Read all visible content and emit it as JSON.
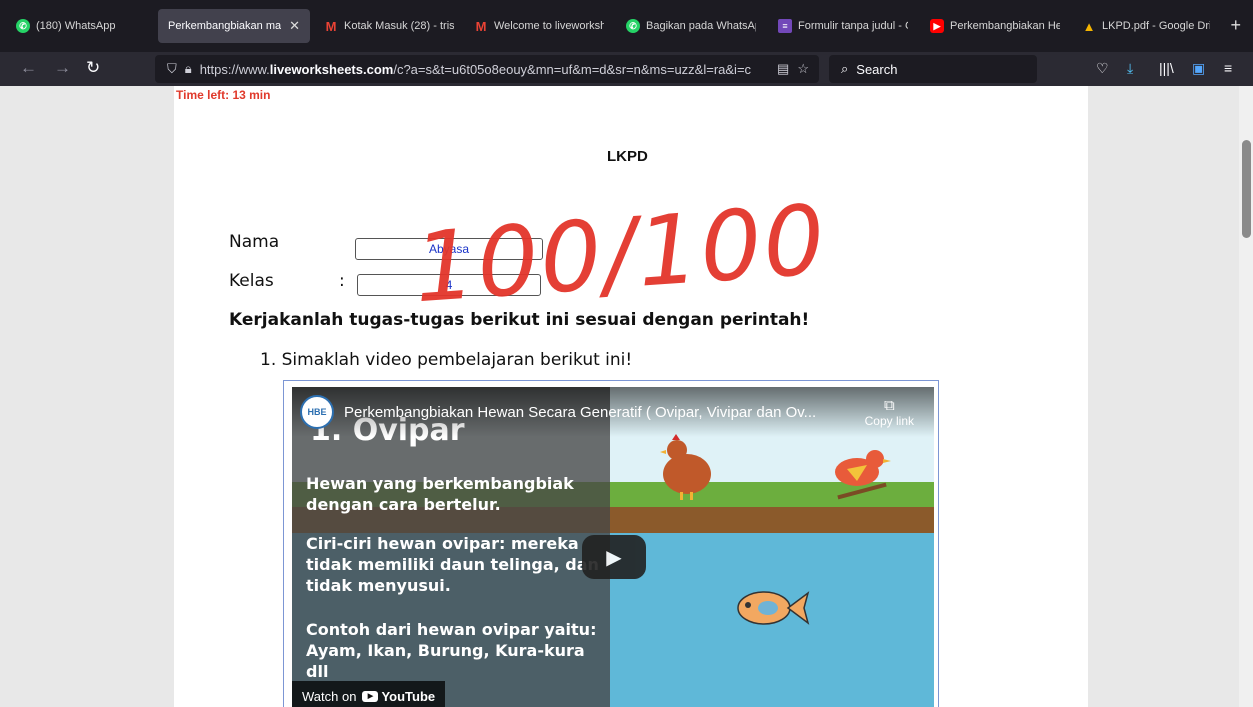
{
  "browser": {
    "tabs": [
      {
        "label": "(180) WhatsApp",
        "icon": "whatsapp-icon",
        "color": "#25d366",
        "active": false
      },
      {
        "label": "Perkembangbiakan mahl",
        "icon": "",
        "color": "",
        "active": true
      },
      {
        "label": "Kotak Masuk (28) - tris",
        "icon": "gmail-icon",
        "color": "#ea4335",
        "active": false
      },
      {
        "label": "Welcome to liveworksh",
        "icon": "gmail-icon",
        "color": "#ea4335",
        "active": false
      },
      {
        "label": "Bagikan pada WhatsAp",
        "icon": "whatsapp-icon",
        "color": "#25d366",
        "active": false
      },
      {
        "label": "Formulir tanpa judul - G",
        "icon": "forms-icon",
        "color": "#7248b9",
        "active": false
      },
      {
        "label": "Perkembangbiakan Hew",
        "icon": "youtube-icon",
        "color": "#ff0000",
        "active": false
      },
      {
        "label": "LKPD.pdf - Google Driv",
        "icon": "drive-icon",
        "color": "#f4b400",
        "active": false
      }
    ],
    "new_tab": "+",
    "url_prefix": "https://www.",
    "url_domain": "liveworksheets.com",
    "url_rest": "/c?a=s&t=u6t05o8eouy&mn=uf&m=d&sr=n&ms=uzz&l=ra&i=c",
    "search_placeholder": "Search"
  },
  "worksheet": {
    "time_left": "Time left: 13 min",
    "title": "LKPD",
    "score": "100/100",
    "name_label": "Nama",
    "name_value": "Abyasa",
    "class_label": "Kelas",
    "class_value": "4",
    "colon": ":",
    "instruction": "Kerjakanlah tugas-tugas berikut ini sesuai dengan perintah!",
    "step1": "1.  Simaklah video pembelajaran berikut ini!"
  },
  "video": {
    "channel": "HBE",
    "title": "Perkembangbiakan Hewan Secara Generatif ( Ovipar, Vivipar dan Ov...",
    "copy_link": "Copy link",
    "heading": "1. Ovipar",
    "text1": "Hewan yang berkembangbiak dengan cara bertelur.",
    "text2": "Ciri-ciri hewan ovipar: mereka tidak memiliki daun telinga, dan tidak menyusui.",
    "text3": "Contoh dari hewan ovipar yaitu: Ayam, Ikan, Burung, Kura-kura dll",
    "watch_on": "Watch on",
    "youtube": "YouTube"
  },
  "colors": {
    "accent_red": "#e3352b",
    "input_text": "#1a33c8",
    "tabbar": "#1c1b22",
    "navbar": "#2b2a33"
  }
}
